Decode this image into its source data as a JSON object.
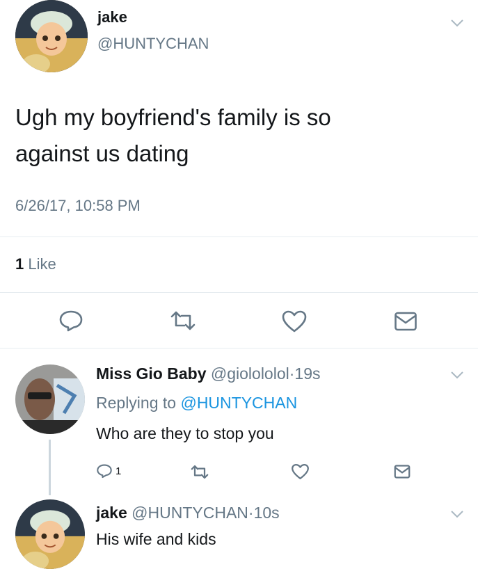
{
  "main_tweet": {
    "display_name": "jake",
    "handle": "@HUNTYCHAN",
    "text_line1": "Ugh my boyfriend's family is so",
    "text_line2": "against us dating",
    "timestamp": "6/26/17, 10:58 PM",
    "likes_number": "1",
    "likes_word": "Like"
  },
  "reply1": {
    "display_name": "Miss Gio Baby",
    "handle": "@giolololol",
    "separator": "·",
    "time": "19s",
    "replying_prefix": "Replying to",
    "replying_handle": "@HUNTYCHAN",
    "text": "Who are they to stop you",
    "reply_count": "1"
  },
  "reply2": {
    "display_name": "jake",
    "handle": "@HUNTYCHAN",
    "separator": "·",
    "time": "10s",
    "text": "His wife and kids"
  },
  "icons": {
    "reply": "reply-icon",
    "retweet": "retweet-icon",
    "like": "heart-icon",
    "dm": "envelope-icon",
    "menu": "chevron-down-icon"
  },
  "colors": {
    "link": "#1b95e0",
    "muted": "#657786",
    "icon": "#657786",
    "divider": "#e6ecf0"
  }
}
